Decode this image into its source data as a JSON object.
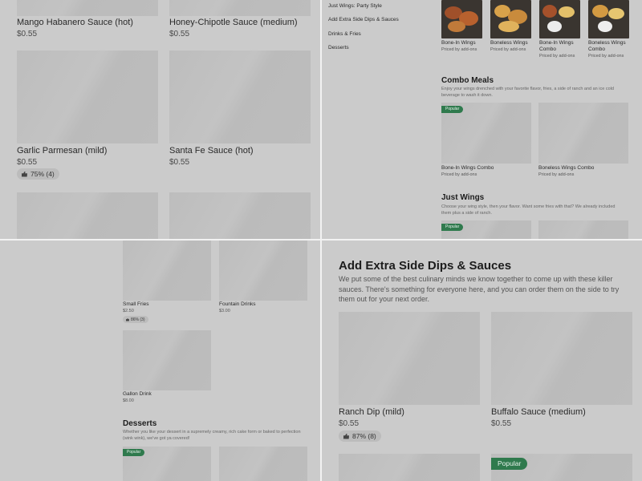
{
  "top_left": {
    "items": [
      {
        "name": "Mango Habanero Sauce (hot)",
        "price": "$0.55"
      },
      {
        "name": "Honey-Chipotle Sauce (medium)",
        "price": "$0.55"
      },
      {
        "name": "Garlic Parmesan (mild)",
        "price": "$0.55",
        "rating": "75% (4)"
      },
      {
        "name": "Santa Fe Sauce (hot)",
        "price": "$0.55"
      }
    ]
  },
  "top_right": {
    "nav": [
      "Just Wings: Party Style",
      "Add Extra Side Dips & Sauces",
      "Drinks & Fries",
      "Desserts"
    ],
    "featured": [
      {
        "name": "Bone-In Wings",
        "sub": "Priced by add-ons"
      },
      {
        "name": "Boneless Wings",
        "sub": "Priced by add-ons"
      },
      {
        "name": "Bone-In Wings Combo",
        "sub": "Priced by add-ons"
      },
      {
        "name": "Boneless Wings Combo",
        "sub": "Priced by add-ons"
      }
    ],
    "combo": {
      "title": "Combo Meals",
      "desc": "Enjoy your wings drenched with your favorite flavor, fries, a side of ranch and an ice cold beverage to wash it down.",
      "badge": "Popular",
      "items": [
        {
          "name": "Bone-In Wings Combo",
          "sub": "Priced by add-ons"
        },
        {
          "name": "Boneless Wings Combo",
          "sub": "Priced by add-ons"
        }
      ]
    },
    "just_wings": {
      "title": "Just Wings",
      "desc": "Choose your wing style, then your flavor. Want some fries with that? We already included them plus a side of ranch.",
      "badge": "Popular"
    }
  },
  "bottom_left": {
    "items": [
      {
        "name": "Small Fries",
        "price": "$2.50",
        "rating": "86% (3)"
      },
      {
        "name": "Fountain Drinks",
        "price": "$3.00"
      },
      {
        "name": "Gallon Drink",
        "price": "$8.00"
      }
    ],
    "desserts": {
      "title": "Desserts",
      "desc": "Whether you like your dessert in a supremely creamy, rich cake form or baked to perfection (wink wink), we've got ya covered!",
      "badge": "Popular"
    }
  },
  "bottom_right": {
    "title": "Add Extra Side Dips & Sauces",
    "desc": "We put some of the best culinary minds we know together to come up with these killer sauces. There's something for everyone here, and you can order them on the side to try them out for your next order.",
    "items": [
      {
        "name": "Ranch Dip (mild)",
        "price": "$0.55",
        "rating": "87% (8)"
      },
      {
        "name": "Buffalo Sauce (medium)",
        "price": "$0.55"
      }
    ],
    "badge": "Popular"
  },
  "colors": {
    "badge_green": "#2f7a4d",
    "overlay_gray": "#cbcbcb"
  }
}
